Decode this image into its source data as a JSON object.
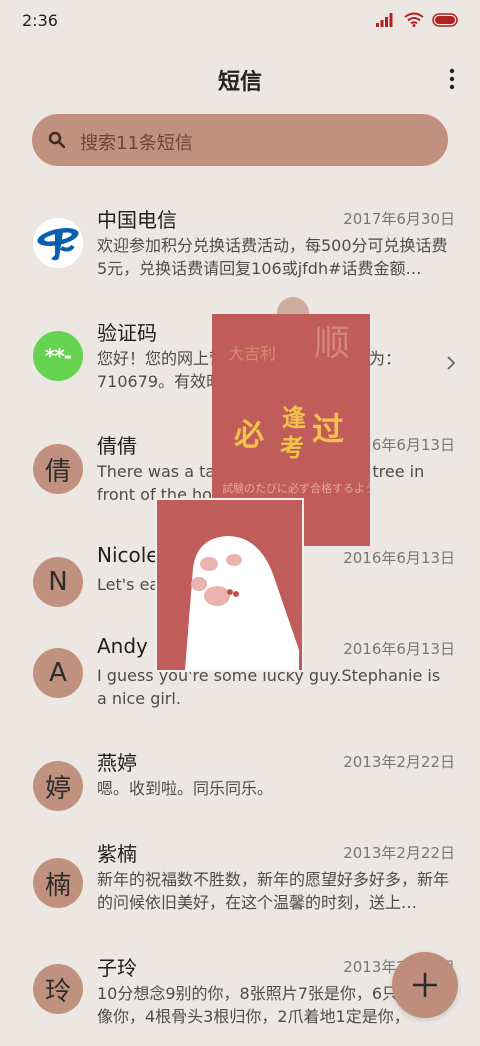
{
  "status": {
    "time": "2:36"
  },
  "header": {
    "title": "短信"
  },
  "search": {
    "placeholder": "搜索11条短信"
  },
  "messages": [
    {
      "name": "中国电信",
      "date": "2017年6月30日",
      "preview": "欢迎参加积分兑换话费活动，每500分可兑换话费5元，兑换话费请回复106或jfdh#话费金额…",
      "avatar_text": ""
    },
    {
      "name": "验证码",
      "date": "",
      "preview": "您好！您的网上营业厅登录的随机密码为：710679。有效时间为3分钟",
      "avatar_text": "**-"
    },
    {
      "name": "倩倩",
      "date": "2016年6月13日",
      "preview": "There was a table set out under a tree in front of the hous",
      "avatar_text": "倩"
    },
    {
      "name": "Nicole",
      "date": "2016年6月13日",
      "preview": "Let's eat out,shall we?",
      "avatar_text": "N"
    },
    {
      "name": "Andy",
      "date": "2016年6月13日",
      "preview": "I guess you're some lucky guy.Stephanie is a nice girl.",
      "avatar_text": "A"
    },
    {
      "name": "燕婷",
      "date": "2013年2月22日",
      "preview": "嗯。收到啦。同乐同乐。",
      "avatar_text": "婷"
    },
    {
      "name": "紫楠",
      "date": "2013年2月22日",
      "preview": "新年的祝福数不胜数，新年的愿望好多好多，新年的问候依旧美好，在这个温馨的时刻，送上…",
      "avatar_text": "楠"
    },
    {
      "name": "子玲",
      "date": "2013年2月22日",
      "preview": "10分想念9别的你，8张照片7张是你，6只猫咪只像你，4根骨头3根归你，2爪着地1定是你，",
      "avatar_text": "玲"
    }
  ],
  "sticker": {
    "top_text": "大吉利",
    "bg_char": "顺",
    "chars": [
      "必",
      "逢",
      "考",
      "过"
    ],
    "bottom_text": "試験のたびに必ず合格するように"
  },
  "icons": {
    "signal": "signal-icon",
    "wifi": "wifi-icon",
    "battery": "battery-icon",
    "more": "more-vertical-icon",
    "search": "search-icon",
    "chevron": "chevron-right-icon",
    "add": "plus-icon"
  },
  "colors": {
    "accent": "#C1917F",
    "background": "#EDE7E3",
    "sticker_red": "#C05C59",
    "green_avatar": "#66D350"
  }
}
